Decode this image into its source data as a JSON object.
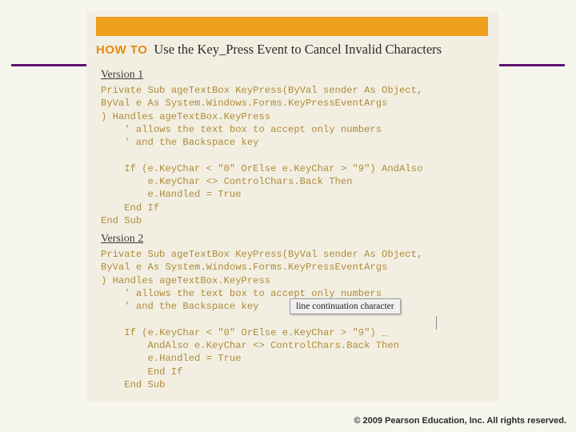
{
  "slide": {
    "howto_label": "HOW TO",
    "title": "Use the Key_Press Event to Cancel Invalid Characters",
    "accent_orange": "#eca01e",
    "accent_purple": "#5b1470",
    "background": "#f7f6ed",
    "panel_background": "#f2efe2"
  },
  "sections": [
    {
      "heading": "Version 1",
      "code": "Private Sub ageTextBox KeyPress(ByVal sender As Object,\nByVal e As System.Windows.Forms.KeyPressEventArgs\n) Handles ageTextBox.KeyPress\n    ' allows the text box to accept only numbers\n    ' and the Backspace key\n\n    If (e.KeyChar < \"0\" OrElse e.KeyChar > \"9\") AndAlso\n        e.KeyChar <> ControlChars.Back Then\n        e.Handled = True\n    End If\nEnd Sub"
    },
    {
      "heading": "Version 2",
      "code": "Private Sub ageTextBox KeyPress(ByVal sender As Object,\nByVal e As System.Windows.Forms.KeyPressEventArgs\n) Handles ageTextBox.KeyPress\n    ' allows the text box to accept only numbers\n    ' and the Backspace key\n\n    If (e.KeyChar < \"0\" OrElse e.KeyChar > \"9\") _\n        AndAlso e.KeyChar <> ControlChars.Back Then\n        e.Handled = True\n        End If\n    End Sub"
    }
  ],
  "callout": {
    "text": "line continuation character"
  },
  "footer": {
    "copyright": "© 2009 Pearson Education, Inc.  All rights reserved."
  }
}
